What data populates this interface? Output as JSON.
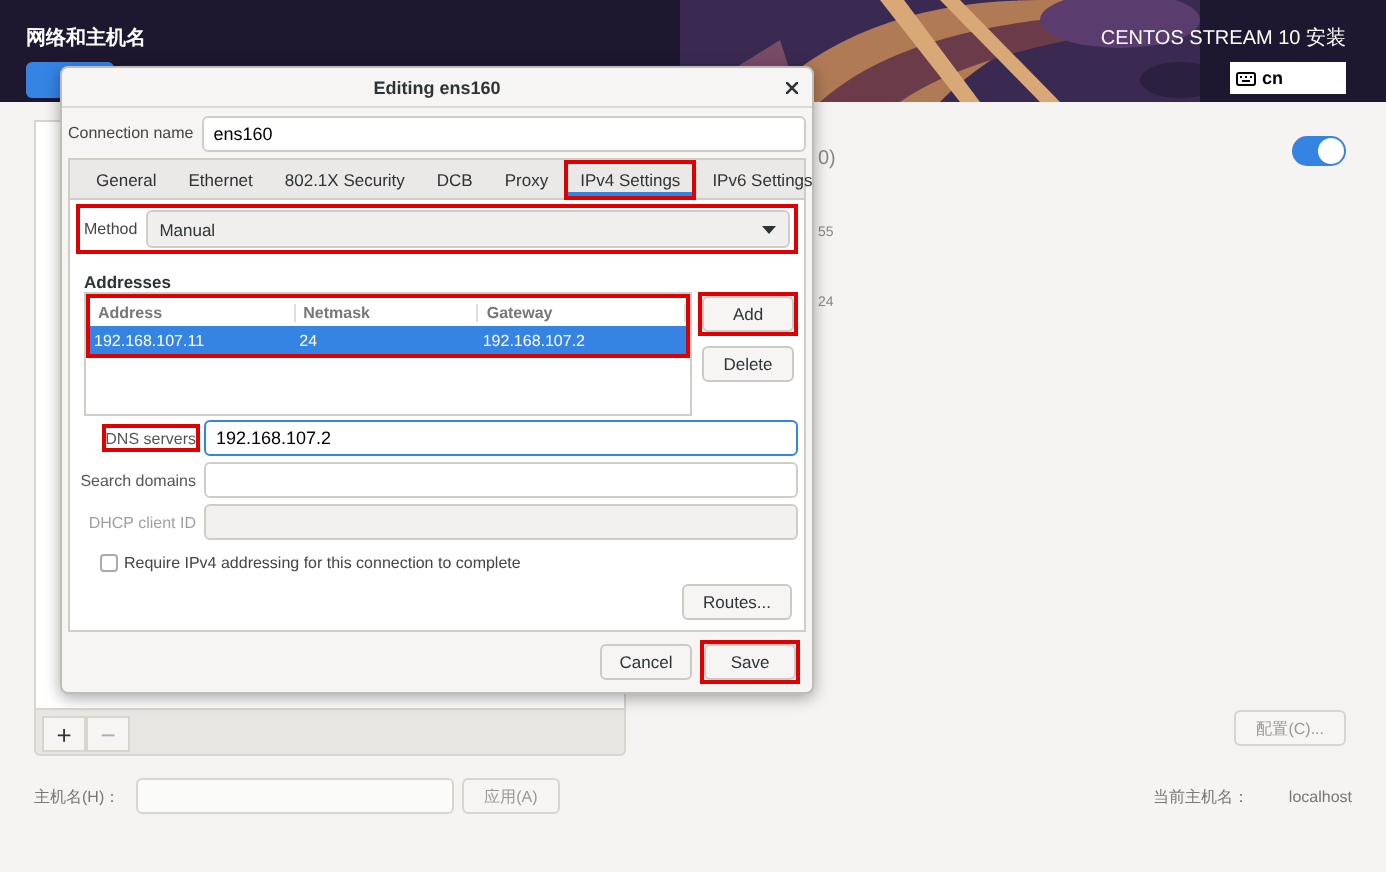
{
  "header": {
    "title": "网络和主机名",
    "product": "CENTOS STREAM 10 安装",
    "keyboard": "cn"
  },
  "background": {
    "device_fragments": [
      "0)",
      "55",
      "24"
    ],
    "device_on": true,
    "list_buttons": [
      {
        "label": "+",
        "disabled": false
      },
      {
        "label": "−",
        "disabled": true
      }
    ],
    "configure_button": {
      "label": "配置(C)...",
      "disabled": true
    },
    "hostname_label": "主机名(H)：",
    "apply_button": {
      "label": "应用(A)",
      "disabled": true
    },
    "current_hostname_label": "当前主机名：",
    "current_hostname": "localhost"
  },
  "dialog": {
    "title": "Editing ens160",
    "connection_name": {
      "label": "Connection name",
      "value": "ens160"
    },
    "tabs": [
      {
        "label": "General",
        "selected": false,
        "highlighted": false
      },
      {
        "label": "Ethernet",
        "selected": false,
        "highlighted": false
      },
      {
        "label": "802.1X Security",
        "selected": false,
        "highlighted": false
      },
      {
        "label": "DCB",
        "selected": false,
        "highlighted": false
      },
      {
        "label": "Proxy",
        "selected": false,
        "highlighted": false
      },
      {
        "label": "IPv4 Settings",
        "selected": true,
        "highlighted": true
      },
      {
        "label": "IPv6 Settings",
        "selected": false,
        "highlighted": false
      }
    ],
    "method": {
      "label": "Method",
      "value": "Manual",
      "highlighted": true
    },
    "addresses": {
      "title": "Addresses",
      "highlighted": true,
      "columns": [
        "Address",
        "Netmask",
        "Gateway"
      ],
      "rows": [
        {
          "cells": [
            "192.168.107.11",
            "24",
            "192.168.107.2"
          ],
          "selected": true
        }
      ]
    },
    "address_buttons": [
      {
        "label": "Add",
        "highlighted": true
      },
      {
        "label": "Delete",
        "highlighted": false
      }
    ],
    "fields": [
      {
        "label": "DNS servers",
        "value": "192.168.107.2",
        "focused": true,
        "disabled": false,
        "highlighted": true
      },
      {
        "label": "Search domains",
        "focused": false,
        "disabled": false,
        "highlighted": false
      },
      {
        "label": "DHCP client ID",
        "focused": false,
        "disabled": true,
        "highlighted": false
      }
    ],
    "require_checkbox": {
      "label": "Require IPv4 addressing for this connection to complete",
      "checked": false
    },
    "routes_button": "Routes...",
    "footer_buttons": [
      {
        "label": "Cancel",
        "highlighted": false
      },
      {
        "label": "Save",
        "highlighted": true
      }
    ]
  }
}
